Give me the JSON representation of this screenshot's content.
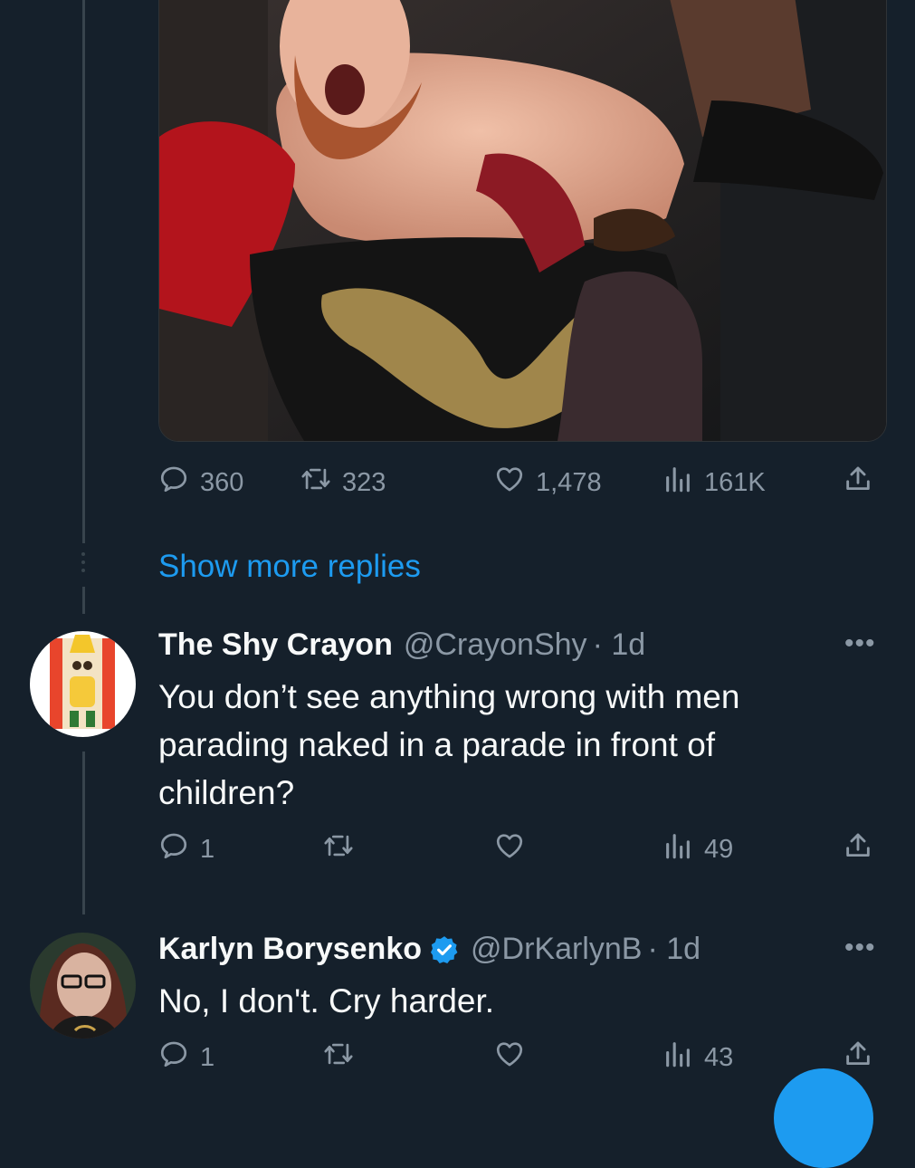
{
  "top_tweet": {
    "stats": {
      "replies": "360",
      "retweets": "323",
      "likes": "1,478",
      "views": "161K"
    }
  },
  "show_more": {
    "label": "Show more replies"
  },
  "reply1": {
    "name": "The Shy Crayon",
    "handle": "@CrayonShy",
    "time": "· 1d",
    "text": "You don’t see anything wrong with men parading naked in a parade in front of children?",
    "stats": {
      "replies": "1",
      "views": "49"
    }
  },
  "reply2": {
    "name": "Karlyn Borysenko",
    "verified": true,
    "handle": "@DrKarlynB",
    "time": "· 1d",
    "text": "No, I don't. Cry harder.",
    "stats": {
      "replies": "1",
      "views": "43"
    }
  },
  "icons": [
    "reply-icon",
    "retweet-icon",
    "like-icon",
    "views-icon",
    "share-icon",
    "more-icon",
    "verified-icon"
  ],
  "colors": {
    "background": "#15202b",
    "accent": "#1d9bf0",
    "muted": "#8b98a5",
    "text": "#f7f9f9"
  }
}
